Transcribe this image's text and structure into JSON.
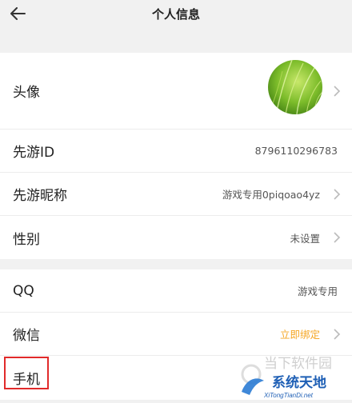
{
  "header": {
    "title": "个人信息"
  },
  "profile": {
    "avatar_label": "头像",
    "id_label": "先游ID",
    "id_value": "8796110296783",
    "nickname_label": "先游昵称",
    "nickname_value": "游戏专用0piqoao4yz",
    "gender_label": "性别",
    "gender_value": "未设置"
  },
  "accounts": {
    "qq_label": "QQ",
    "qq_value": "游戏专用",
    "wechat_label": "微信",
    "wechat_value": "立即绑定",
    "phone_label": "手机"
  },
  "watermark": {
    "brand_top": "当下软件园",
    "brand_main": "系统天地",
    "brand_url": "XiTongTianDi.net"
  },
  "colors": {
    "accent": "#f5a623",
    "highlight": "#e12a2a",
    "background": "#f1f1f1"
  }
}
